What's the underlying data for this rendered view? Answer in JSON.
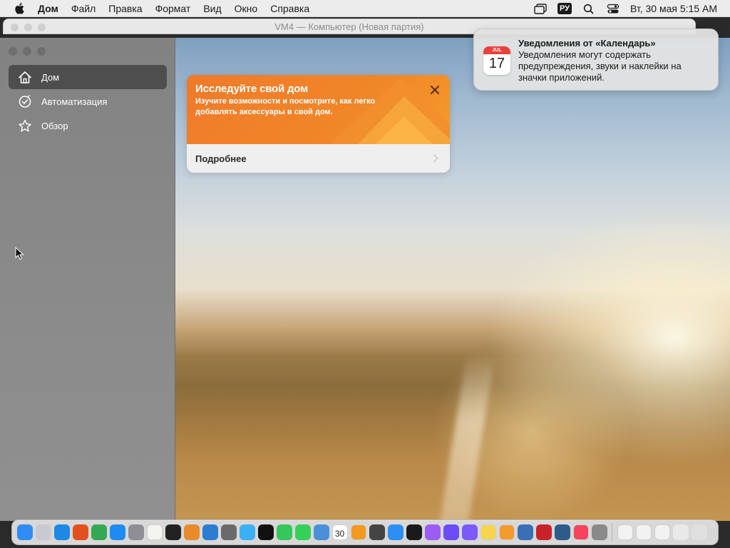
{
  "menubar": {
    "apple_icon": "apple-logo-icon",
    "app_name": "Дом",
    "items": [
      "Файл",
      "Правка",
      "Формат",
      "Вид",
      "Окно",
      "Справка"
    ],
    "input_language": "РУ",
    "clock": "Вт, 30 мая  5:15 AM",
    "status_icons": [
      "screen-mirroring-icon",
      "input-source-icon",
      "spotlight-search-icon",
      "control-center-icon"
    ]
  },
  "background_window": {
    "title": "VM4 — Компьютер  (Новая партия)"
  },
  "sidebar": {
    "items": [
      {
        "label": "Дом",
        "icon": "house-icon",
        "active": true
      },
      {
        "label": "Автоматизация",
        "icon": "clock-check-icon",
        "active": false
      },
      {
        "label": "Обзор",
        "icon": "star-icon",
        "active": false
      }
    ]
  },
  "card": {
    "title": "Исследуйте свой дом",
    "description": "Изучите возможности и посмотрите, как легко добавлять аксессуары в свой дом.",
    "link_label": "Подробнее"
  },
  "notification": {
    "title": "Уведомления от «Календарь»",
    "body": "Уведомления могут содержать предупреждения, звуки и наклейки на значки приложений.",
    "icon_month": "JUL",
    "icon_day": "17"
  },
  "dock": {
    "apps": [
      {
        "name": "finder",
        "color": "#2f8df3"
      },
      {
        "name": "launchpad",
        "color": "#c9c9d1"
      },
      {
        "name": "safari",
        "color": "#1e88e5"
      },
      {
        "name": "firefox",
        "color": "#e3501e"
      },
      {
        "name": "chrome",
        "color": "#34a853"
      },
      {
        "name": "app-store",
        "color": "#1d8bf1"
      },
      {
        "name": "system-settings",
        "color": "#8e8e93"
      },
      {
        "name": "textedit",
        "color": "#f5f5f0"
      },
      {
        "name": "terminal",
        "color": "#222222"
      },
      {
        "name": "garageband",
        "color": "#e98a2b"
      },
      {
        "name": "vscode",
        "color": "#2a7dd1"
      },
      {
        "name": "chess",
        "color": "#6a6a6a"
      },
      {
        "name": "freeform",
        "color": "#3bb0f5"
      },
      {
        "name": "apple-tv",
        "color": "#111111"
      },
      {
        "name": "facetime",
        "color": "#34c759"
      },
      {
        "name": "messages",
        "color": "#35d05a"
      },
      {
        "name": "preview",
        "color": "#4a90d9"
      },
      {
        "name": "calendar",
        "color": "#ffffff"
      },
      {
        "name": "books",
        "color": "#f39a1f"
      },
      {
        "name": "calculator",
        "color": "#444444"
      },
      {
        "name": "keynote",
        "color": "#2d8ff5"
      },
      {
        "name": "clock",
        "color": "#1a1a1a"
      },
      {
        "name": "podcasts",
        "color": "#9d5cf5"
      },
      {
        "name": "shortcuts",
        "color": "#6b4cf6"
      },
      {
        "name": "notes-mini",
        "color": "#7a5af8"
      },
      {
        "name": "notes",
        "color": "#f7d54a"
      },
      {
        "name": "home",
        "color": "#f39b2a"
      },
      {
        "name": "quicktime",
        "color": "#3a6fb5"
      },
      {
        "name": "photo-booth",
        "color": "#c8222b"
      },
      {
        "name": "screen-sharing",
        "color": "#2e5c8a"
      },
      {
        "name": "music",
        "color": "#f5445c"
      },
      {
        "name": "xcode-tools",
        "color": "#8a8a8a"
      }
    ],
    "recent": [
      {
        "name": "document-1",
        "color": "#f2f2f2"
      },
      {
        "name": "document-2",
        "color": "#f2f2f2"
      },
      {
        "name": "document-3",
        "color": "#f2f2f2"
      },
      {
        "name": "document-4",
        "color": "#e9e9e9"
      },
      {
        "name": "trash",
        "color": "#e0e0e0"
      }
    ],
    "calendar_day": "30"
  }
}
